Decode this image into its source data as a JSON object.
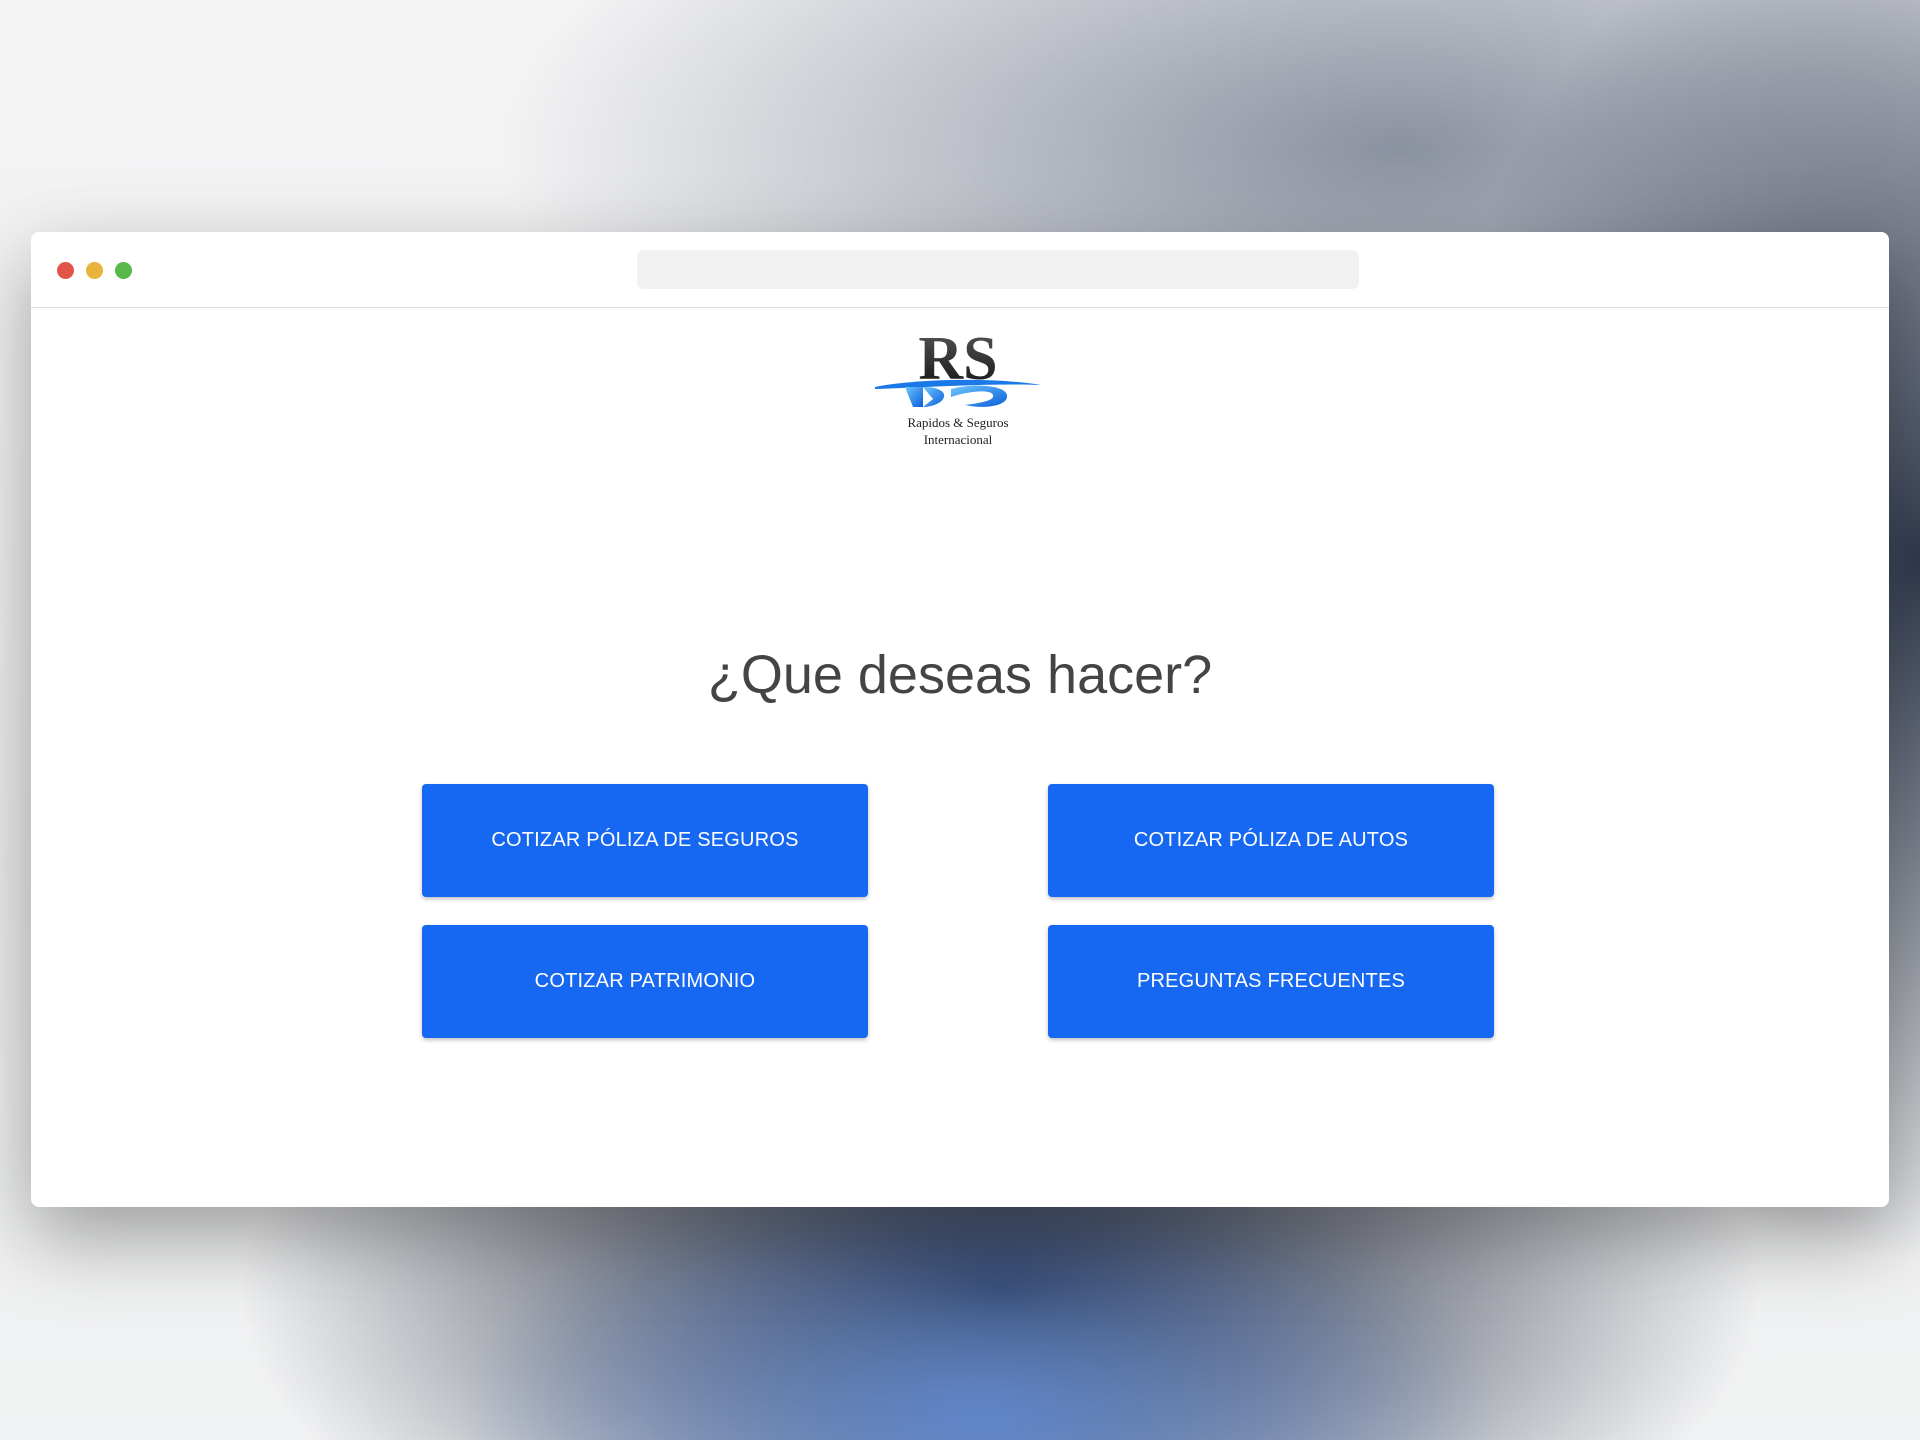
{
  "window": {
    "controls": [
      "close",
      "minimize",
      "maximize"
    ]
  },
  "logo": {
    "monogram": "RS",
    "line1": "Rapidos & Seguros",
    "line2": "Internacional"
  },
  "page": {
    "heading": "¿Que deseas hacer?"
  },
  "actions": [
    {
      "label": "COTIZAR PÓLIZA DE SEGUROS"
    },
    {
      "label": "COTIZAR PÓLIZA DE AUTOS"
    },
    {
      "label": "COTIZAR PATRIMONIO"
    },
    {
      "label": "PREGUNTAS FRECUENTES"
    }
  ],
  "colors": {
    "button": "#1668f2",
    "button_text": "#ffffff",
    "heading": "#444444",
    "close": "#e2554b",
    "minimize": "#e8b23b",
    "maximize": "#56b949"
  }
}
